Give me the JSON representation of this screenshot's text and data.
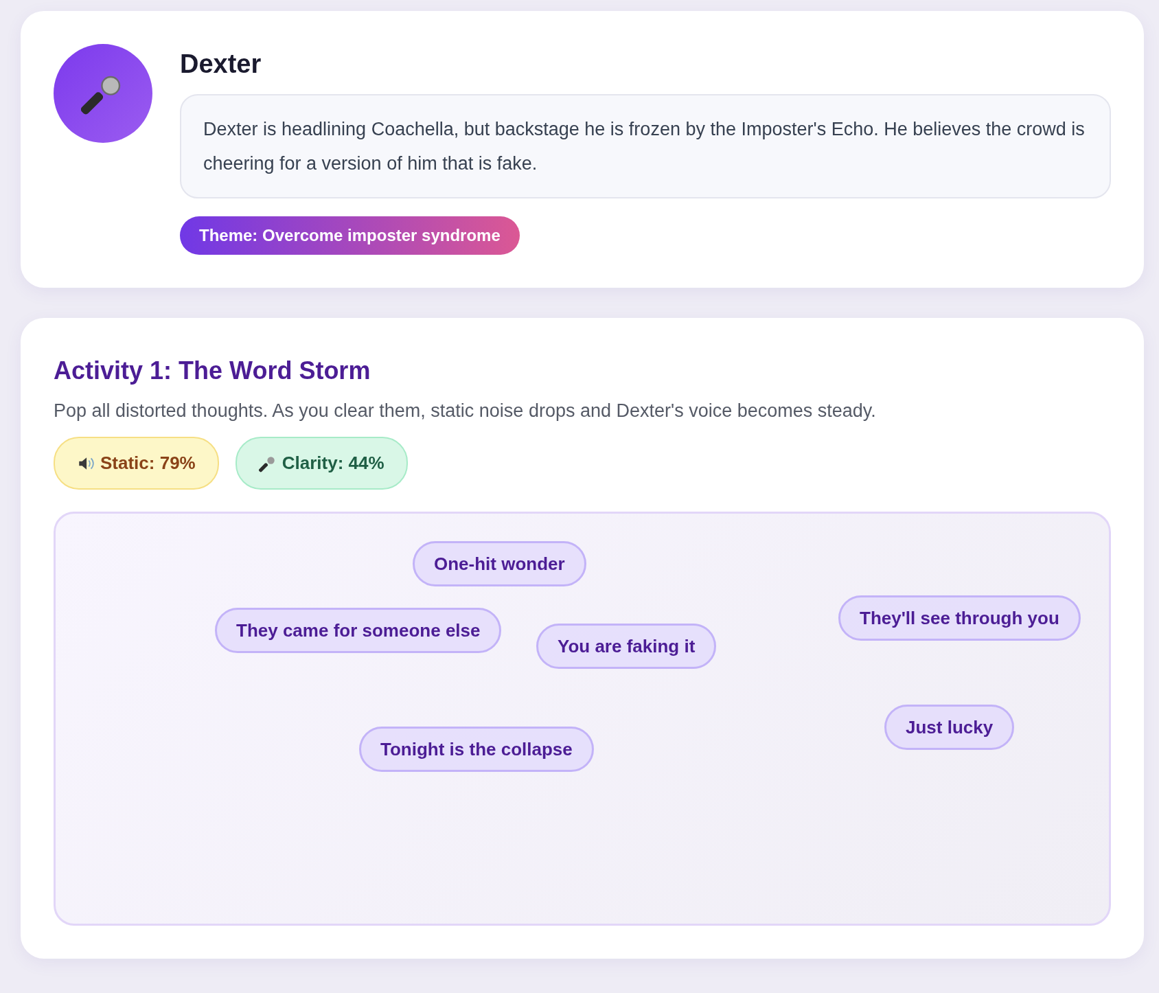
{
  "profile": {
    "name": "Dexter",
    "story": "Dexter is headlining Coachella, but backstage he is frozen by the Imposter's Echo. He believes the crowd is cheering for a version of him that is fake.",
    "theme": "Theme: Overcome imposter syndrome"
  },
  "activity": {
    "title": "Activity 1: The Word Storm",
    "instructions": "Pop all distorted thoughts. As you clear them, static noise drops and Dexter's voice becomes steady.",
    "meters": [
      {
        "kind": "static",
        "label": "Static: 79%"
      },
      {
        "kind": "clarity",
        "label": "Clarity: 44%"
      }
    ],
    "thoughts": [
      "They came for someone else",
      "One-hit wonder",
      "You are faking it",
      "They'll see through you",
      "Just lucky",
      "Tonight is the collapse"
    ]
  }
}
